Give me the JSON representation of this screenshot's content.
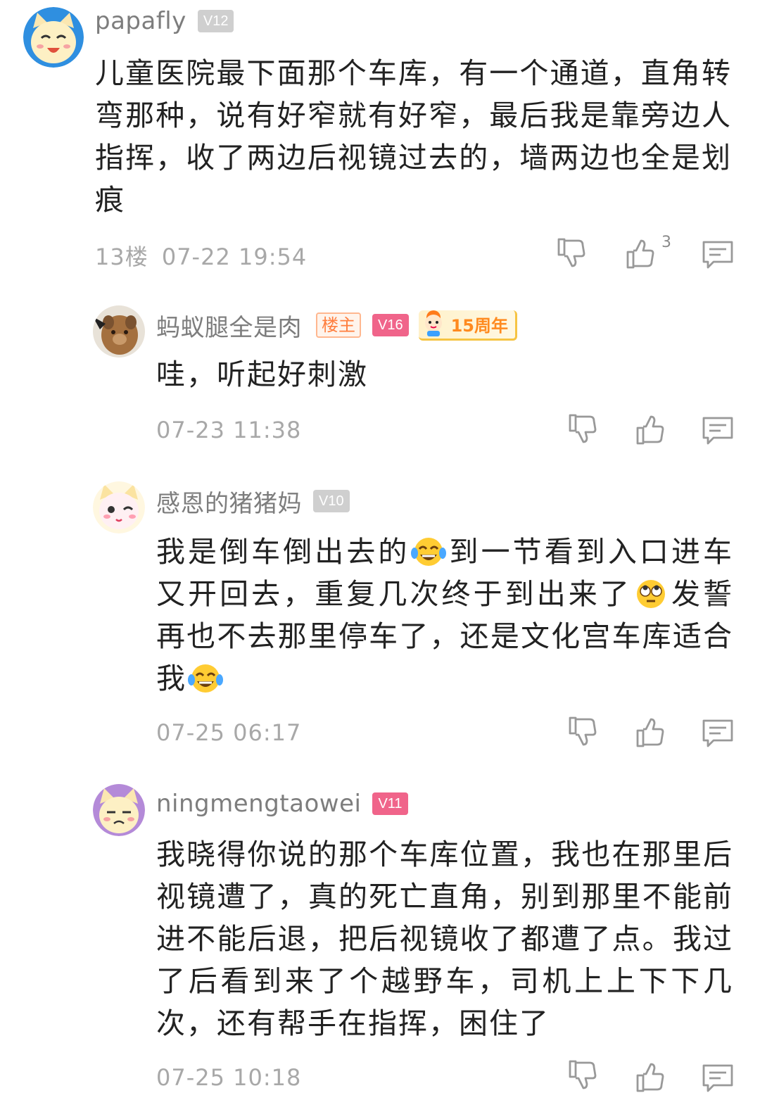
{
  "comments": [
    {
      "username": "papafly",
      "level": "V12",
      "text": "儿童医院最下面那个车库，有一个通道，直角转弯那种，说有好窄就有好窄，最后我是靠旁边人指挥，收了两边后视镜过去的，墙两边也全是划痕",
      "floor": "13楼",
      "time": "07-22 19:54",
      "likes": "3"
    },
    {
      "username": "蚂蚁腿全是肉",
      "owner_badge": "楼主",
      "level": "V16",
      "anniversary_badge": "15周年",
      "text": "哇，听起好刺激",
      "time": "07-23 11:38"
    },
    {
      "username": "感恩的猪猪妈",
      "level": "V10",
      "text_parts": [
        "我是倒车倒出去的",
        "到一节看到入口进车又开回去，重复几次终于到出来了",
        "发誓再也不去那里停车了，还是文化宫车库适合我",
        ""
      ],
      "emojis": [
        "tears-of-joy-emoji",
        "eye-roll-emoji",
        "tears-of-joy-emoji"
      ],
      "time": "07-25 06:17"
    },
    {
      "username": "ningmengtaowei",
      "level": "V11",
      "text": "我晓得你说的那个车库位置，我也在那里后视镜遭了，真的死亡直角，别到那里不能前进不能后退，把后视镜收了都遭了点。我过了后看到来了个越野车，司机上上下下几次，还有帮手在指挥，困住了",
      "time": "07-25 10:18"
    }
  ],
  "icons": [
    "dislike-icon",
    "like-icon",
    "reply-icon"
  ],
  "colors": {
    "username": "#7d7d7d",
    "level_gray": "#cfcfcf",
    "level_pink": "#f0648a",
    "owner": "#ff7e3e",
    "meta": "#a8a8a8"
  }
}
